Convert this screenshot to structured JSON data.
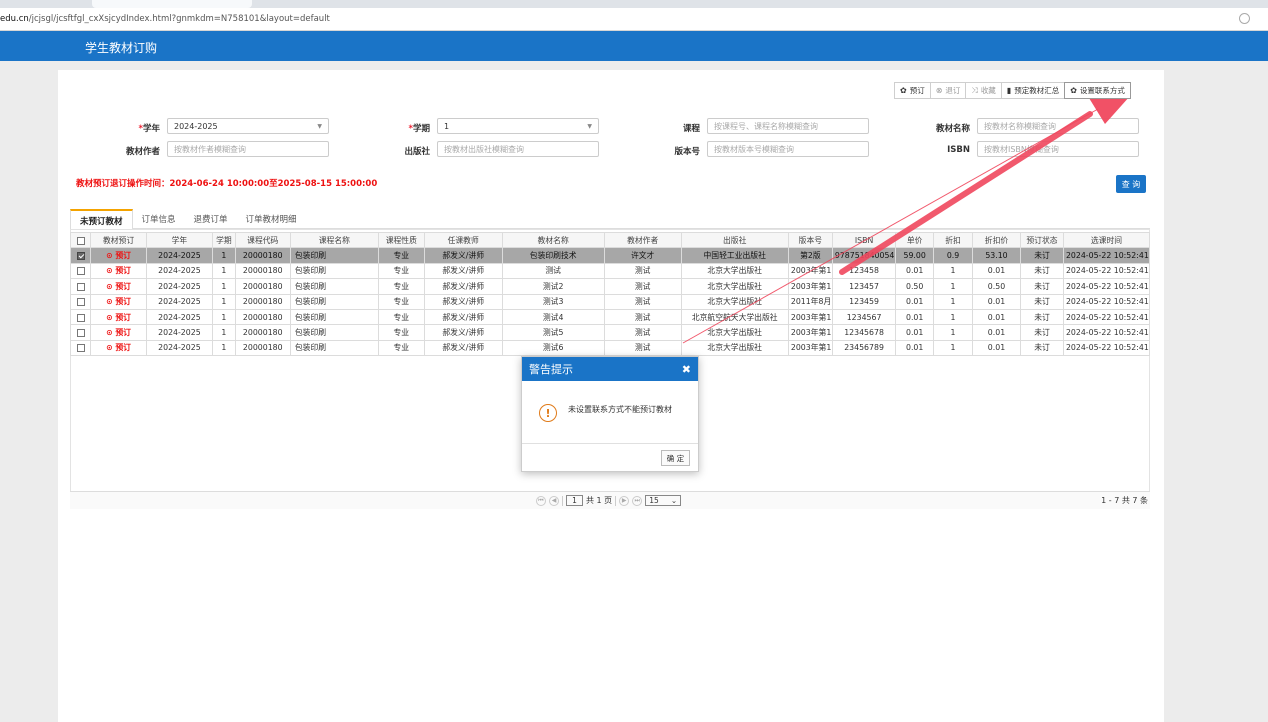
{
  "browser": {
    "url_domain": "edu.cn",
    "url_path": "/jcjsgl/jcsftfgl_cxXsjcydIndex.html?gnmkdm=N758101&layout=default"
  },
  "header": {
    "title": "学生教材订购"
  },
  "toolbar": {
    "buttons": [
      {
        "label": "预订",
        "icon": "gear-icon"
      },
      {
        "label": "退订",
        "icon": "cancel-circle-icon"
      },
      {
        "label": "收藏",
        "icon": "shuffle-icon"
      },
      {
        "label": "预定教材汇总",
        "icon": "bar-chart-icon"
      },
      {
        "label": "设置联系方式",
        "icon": "gear-icon"
      }
    ]
  },
  "filters": {
    "year_label": "学年",
    "year_value": "2024-2025",
    "term_label": "学期",
    "term_value": "1",
    "course_label": "课程",
    "course_placeholder": "按课程号、课程名称模糊查询",
    "material_name_label": "教材名称",
    "material_name_placeholder": "按教材名称模糊查询",
    "author_label": "教材作者",
    "author_placeholder": "按教材作者模糊查询",
    "publisher_label": "出版社",
    "publisher_placeholder": "按教材出版社模糊查询",
    "edition_label": "版本号",
    "edition_placeholder": "按教材版本号模糊查询",
    "isbn_label": "ISBN",
    "isbn_placeholder": "按教材ISBN模糊查询"
  },
  "notice": "教材预订退订操作时间：2024-06-24 10:00:00至2025-08-15 15:00:00",
  "query_button": "查 询",
  "tabs": [
    "未预订教材",
    "订单信息",
    "退费订单",
    "订单教材明细"
  ],
  "table": {
    "columns": [
      "教材预订",
      "学年",
      "学期",
      "课程代码",
      "课程名称",
      "课程性质",
      "任课教师",
      "教材名称",
      "教材作者",
      "出版社",
      "版本号",
      "ISBN",
      "单价",
      "折扣",
      "折扣价",
      "预订状态",
      "选课时间"
    ],
    "order_label": "预订",
    "rows": [
      {
        "selected": true,
        "cells": [
          "2024-2025",
          "1",
          "20000180",
          "包装印刷",
          "专业",
          "郝发义/讲师",
          "包装印刷技术",
          "许文才",
          "中国轻工业出版社",
          "第2版",
          "9787518400546",
          "59.00",
          "0.9",
          "53.10",
          "未订",
          "2024-05-22 10:52:41"
        ]
      },
      {
        "selected": false,
        "cells": [
          "2024-2025",
          "1",
          "20000180",
          "包装印刷",
          "专业",
          "郝发义/讲师",
          "测试",
          "测试",
          "北京大学出版社",
          "2003年第1",
          "123458",
          "0.01",
          "1",
          "0.01",
          "未订",
          "2024-05-22 10:52:41"
        ]
      },
      {
        "selected": false,
        "cells": [
          "2024-2025",
          "1",
          "20000180",
          "包装印刷",
          "专业",
          "郝发义/讲师",
          "测试2",
          "测试",
          "北京大学出版社",
          "2003年第1",
          "123457",
          "0.50",
          "1",
          "0.50",
          "未订",
          "2024-05-22 10:52:41"
        ]
      },
      {
        "selected": false,
        "cells": [
          "2024-2025",
          "1",
          "20000180",
          "包装印刷",
          "专业",
          "郝发义/讲师",
          "测试3",
          "测试",
          "北京大学出版社",
          "2011年8月",
          "123459",
          "0.01",
          "1",
          "0.01",
          "未订",
          "2024-05-22 10:52:41"
        ]
      },
      {
        "selected": false,
        "cells": [
          "2024-2025",
          "1",
          "20000180",
          "包装印刷",
          "专业",
          "郝发义/讲师",
          "测试4",
          "测试",
          "北京航空航天大学出版社",
          "2003年第1",
          "1234567",
          "0.01",
          "1",
          "0.01",
          "未订",
          "2024-05-22 10:52:41"
        ]
      },
      {
        "selected": false,
        "cells": [
          "2024-2025",
          "1",
          "20000180",
          "包装印刷",
          "专业",
          "郝发义/讲师",
          "测试5",
          "测试",
          "北京大学出版社",
          "2003年第1",
          "12345678",
          "0.01",
          "1",
          "0.01",
          "未订",
          "2024-05-22 10:52:41"
        ]
      },
      {
        "selected": false,
        "cells": [
          "2024-2025",
          "1",
          "20000180",
          "包装印刷",
          "专业",
          "郝发义/讲师",
          "测试6",
          "测试",
          "北京大学出版社",
          "2003年第1",
          "23456789",
          "0.01",
          "1",
          "0.01",
          "未订",
          "2024-05-22 10:52:41"
        ]
      }
    ]
  },
  "pager": {
    "page": "1",
    "total_pages_text": "共 1 页",
    "page_size": "15",
    "count_text": "1 - 7  共 7 条"
  },
  "dialog": {
    "title": "警告提示",
    "message": "未设置联系方式不能预订教材",
    "ok_label": "确 定"
  },
  "colors": {
    "brand": "#1a74c7",
    "alert": "#e11111",
    "arrow": "#f0485e"
  }
}
